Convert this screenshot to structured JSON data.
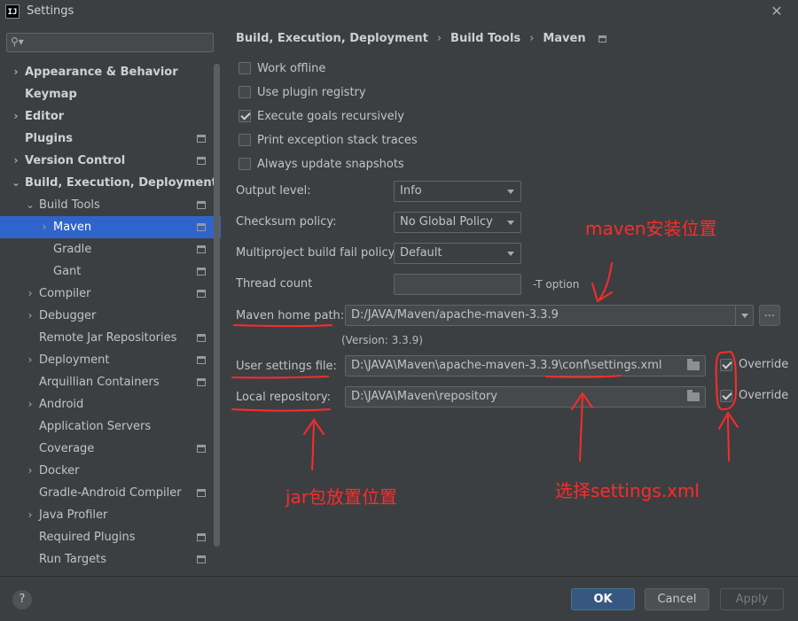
{
  "window": {
    "app_icon": "IJ",
    "title": "Settings",
    "close_label": "✕"
  },
  "sidebar": {
    "search_placeholder": "",
    "items": [
      {
        "label": "Appearance & Behavior",
        "level": 0,
        "arrow": "›",
        "bold": true
      },
      {
        "label": "Keymap",
        "level": 0,
        "arrow": "",
        "bold": true
      },
      {
        "label": "Editor",
        "level": 0,
        "arrow": "›",
        "bold": true
      },
      {
        "label": "Plugins",
        "level": 0,
        "arrow": "",
        "bold": true,
        "icon": true
      },
      {
        "label": "Version Control",
        "level": 0,
        "arrow": "›",
        "bold": true,
        "icon": true
      },
      {
        "label": "Build, Execution, Deployment",
        "level": 0,
        "arrow": "⌄",
        "bold": true
      },
      {
        "label": "Build Tools",
        "level": 1,
        "arrow": "⌄",
        "icon": true
      },
      {
        "label": "Maven",
        "level": 2,
        "arrow": "›",
        "icon": true,
        "selected": true
      },
      {
        "label": "Gradle",
        "level": 2,
        "arrow": "",
        "icon": true
      },
      {
        "label": "Gant",
        "level": 2,
        "arrow": "",
        "icon": true
      },
      {
        "label": "Compiler",
        "level": 1,
        "arrow": "›",
        "icon": true
      },
      {
        "label": "Debugger",
        "level": 1,
        "arrow": "›"
      },
      {
        "label": "Remote Jar Repositories",
        "level": 1,
        "arrow": "",
        "icon": true
      },
      {
        "label": "Deployment",
        "level": 1,
        "arrow": "›",
        "icon": true
      },
      {
        "label": "Arquillian Containers",
        "level": 1,
        "arrow": "",
        "icon": true
      },
      {
        "label": "Android",
        "level": 1,
        "arrow": "›"
      },
      {
        "label": "Application Servers",
        "level": 1,
        "arrow": ""
      },
      {
        "label": "Coverage",
        "level": 1,
        "arrow": "",
        "icon": true
      },
      {
        "label": "Docker",
        "level": 1,
        "arrow": "›"
      },
      {
        "label": "Gradle-Android Compiler",
        "level": 1,
        "arrow": "",
        "icon": true
      },
      {
        "label": "Java Profiler",
        "level": 1,
        "arrow": "›"
      },
      {
        "label": "Required Plugins",
        "level": 1,
        "arrow": "",
        "icon": true
      },
      {
        "label": "Run Targets",
        "level": 1,
        "arrow": "",
        "icon": true
      }
    ]
  },
  "breadcrumb": {
    "parts": [
      "Build, Execution, Deployment",
      "Build Tools",
      "Maven"
    ],
    "separator": "›"
  },
  "options": {
    "work_offline": {
      "label": "Work offline",
      "checked": false
    },
    "use_plugin_registry": {
      "label": "Use plugin registry",
      "checked": false
    },
    "execute_goals_recursively": {
      "label": "Execute goals recursively",
      "checked": true
    },
    "print_exception_stack_traces": {
      "label": "Print exception stack traces",
      "checked": false
    },
    "always_update_snapshots": {
      "label": "Always update snapshots",
      "checked": false
    }
  },
  "fields": {
    "output_level": {
      "label": "Output level:",
      "value": "Info"
    },
    "checksum_policy": {
      "label": "Checksum policy:",
      "value": "No Global Policy"
    },
    "multiproject_fail_policy": {
      "label": "Multiproject build fail policy:",
      "value": "Default"
    },
    "thread_count": {
      "label": "Thread count",
      "value": "",
      "hint": "-T option"
    },
    "maven_home": {
      "label": "Maven home path:",
      "value": "D:/JAVA/Maven/apache-maven-3.3.9",
      "version": "(Version: 3.3.9)",
      "browse": "..."
    },
    "user_settings": {
      "label": "User settings file:",
      "value": "D:\\JAVA\\Maven\\apache-maven-3.3.9\\conf\\settings.xml",
      "override_label": "Override",
      "override_checked": true
    },
    "local_repository": {
      "label": "Local repository:",
      "value": "D:\\JAVA\\Maven\\repository",
      "override_label": "Override",
      "override_checked": true
    }
  },
  "annotations": {
    "maven_home": "maven安装位置",
    "jar_location": "jar包放置位置",
    "select_settings": "选择settings.xml",
    "color": "#ff2a2a"
  },
  "footer": {
    "help": "?",
    "ok": "OK",
    "cancel": "Cancel",
    "apply": "Apply"
  }
}
